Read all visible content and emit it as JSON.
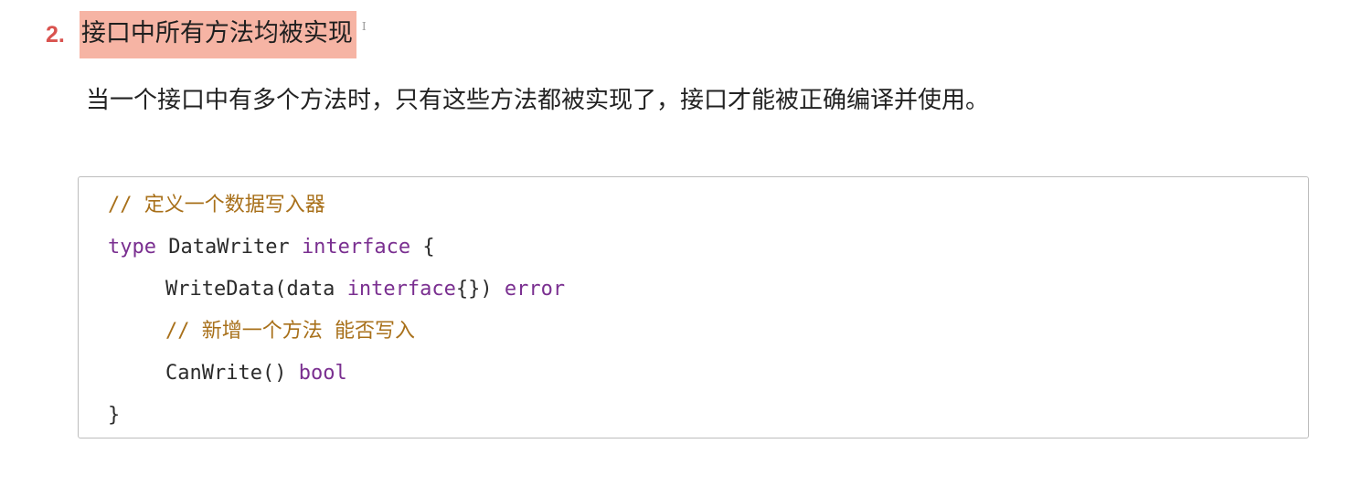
{
  "heading": {
    "number": "2.",
    "title": "接口中所有方法均被实现",
    "cursor": "I"
  },
  "paragraph": "当一个接口中有多个方法时，只有这些方法都被实现了，接口才能被正确编译并使用。",
  "code": {
    "line1_comment": "// 定义一个数据写入器",
    "line2_kw1": "type",
    "line2_name": " DataWriter ",
    "line2_kw2": "interface",
    "line2_brace": " {",
    "line3_method": "WriteData(data ",
    "line3_kw": "interface",
    "line3_rest": "{}) ",
    "line3_kw2": "error",
    "line4_comment": "// 新增一个方法 能否写入",
    "line5_method": "CanWrite() ",
    "line5_kw": "bool",
    "line6_brace": "}"
  },
  "colors": {
    "heading_number": "#d9534f",
    "heading_highlight": "#f6b4a4",
    "comment": "#a8701a",
    "keyword": "#7a2f90"
  }
}
